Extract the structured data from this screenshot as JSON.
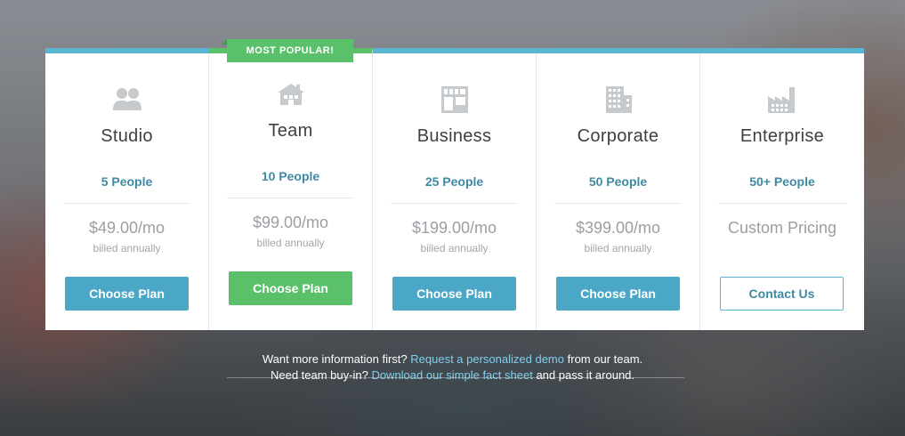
{
  "colors": {
    "accent_blue": "#4aa7c6",
    "accent_green": "#5ac06a",
    "people_text": "#3e8aa4",
    "link": "#7fd0ee"
  },
  "plans": [
    {
      "name": "Studio",
      "people": "5 People",
      "price": "$49.00/mo",
      "billing": "billed annually",
      "button": "Choose Plan",
      "icon": "users-icon"
    },
    {
      "name": "Team",
      "people": "10 People",
      "price": "$99.00/mo",
      "billing": "billed annually",
      "button": "Choose Plan",
      "icon": "house-icon",
      "badge": "MOST POPULAR!"
    },
    {
      "name": "Business",
      "people": "25 People",
      "price": "$199.00/mo",
      "billing": "billed annually",
      "button": "Choose Plan",
      "icon": "storefront-icon"
    },
    {
      "name": "Corporate",
      "people": "50 People",
      "price": "$399.00/mo",
      "billing": "billed annually",
      "button": "Choose Plan",
      "icon": "office-building-icon"
    },
    {
      "name": "Enterprise",
      "people": "50+ People",
      "price": "Custom Pricing",
      "billing": "",
      "button": "Contact Us",
      "icon": "factory-icon"
    }
  ],
  "footer": {
    "line1_before": "Want more information first?",
    "line1_link": "Request a personalized demo",
    "line1_after": "from our team.",
    "line2_before": "Need team buy-in?",
    "line2_link": "Download our simple fact sheet",
    "line2_after": "and pass it around."
  }
}
